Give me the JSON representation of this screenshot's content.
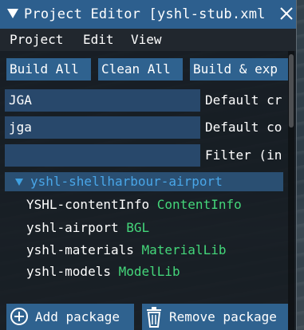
{
  "window": {
    "title": "Project Editor [yshl-stub.xml"
  },
  "menu": {
    "items": [
      "Project",
      "Edit",
      "View"
    ]
  },
  "toolbar": {
    "build_all": "Build All",
    "clean_all": "Clean All",
    "build_export": "Build & exp"
  },
  "fields": {
    "creator_value": "JGA",
    "creator_label": "Default cr",
    "company_value": "jga",
    "company_label": "Default co",
    "filter_value": "",
    "filter_label": "Filter (in"
  },
  "tree": {
    "root_label": "yshl-shellharbour-airport",
    "items": [
      {
        "name": "YSHL-contentInfo",
        "type": "ContentInfo"
      },
      {
        "name": "yshl-airport",
        "type": "BGL"
      },
      {
        "name": "yshl-materials",
        "type": "MaterialLib"
      },
      {
        "name": "yshl-models",
        "type": "ModelLib"
      }
    ]
  },
  "footer": {
    "add_label": "Add package",
    "remove_label": "Remove package"
  },
  "colors": {
    "accent": "#2f628f",
    "title_bar": "#2d5f8e",
    "tree_root_text": "#49a6e8",
    "type_text": "#44d67a"
  },
  "icons": [
    "collapse-icon",
    "close-icon",
    "expand-arrow-icon",
    "add-circle-icon",
    "trash-icon"
  ]
}
